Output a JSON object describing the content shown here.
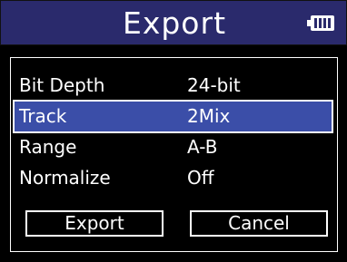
{
  "header": {
    "title": "Export",
    "battery_icon": "battery-full-icon"
  },
  "settings": [
    {
      "label": "Bit Depth",
      "value": "24-bit",
      "selected": false
    },
    {
      "label": "Track",
      "value": "2Mix",
      "selected": true
    },
    {
      "label": "Range",
      "value": "A-B",
      "selected": false
    },
    {
      "label": "Normalize",
      "value": "Off",
      "selected": false
    }
  ],
  "buttons": {
    "export_label": "Export",
    "cancel_label": "Cancel"
  },
  "colors": {
    "titlebar": "#2a2a6c",
    "selection": "#3b4ea8",
    "background": "#000000",
    "text": "#ffffff"
  }
}
